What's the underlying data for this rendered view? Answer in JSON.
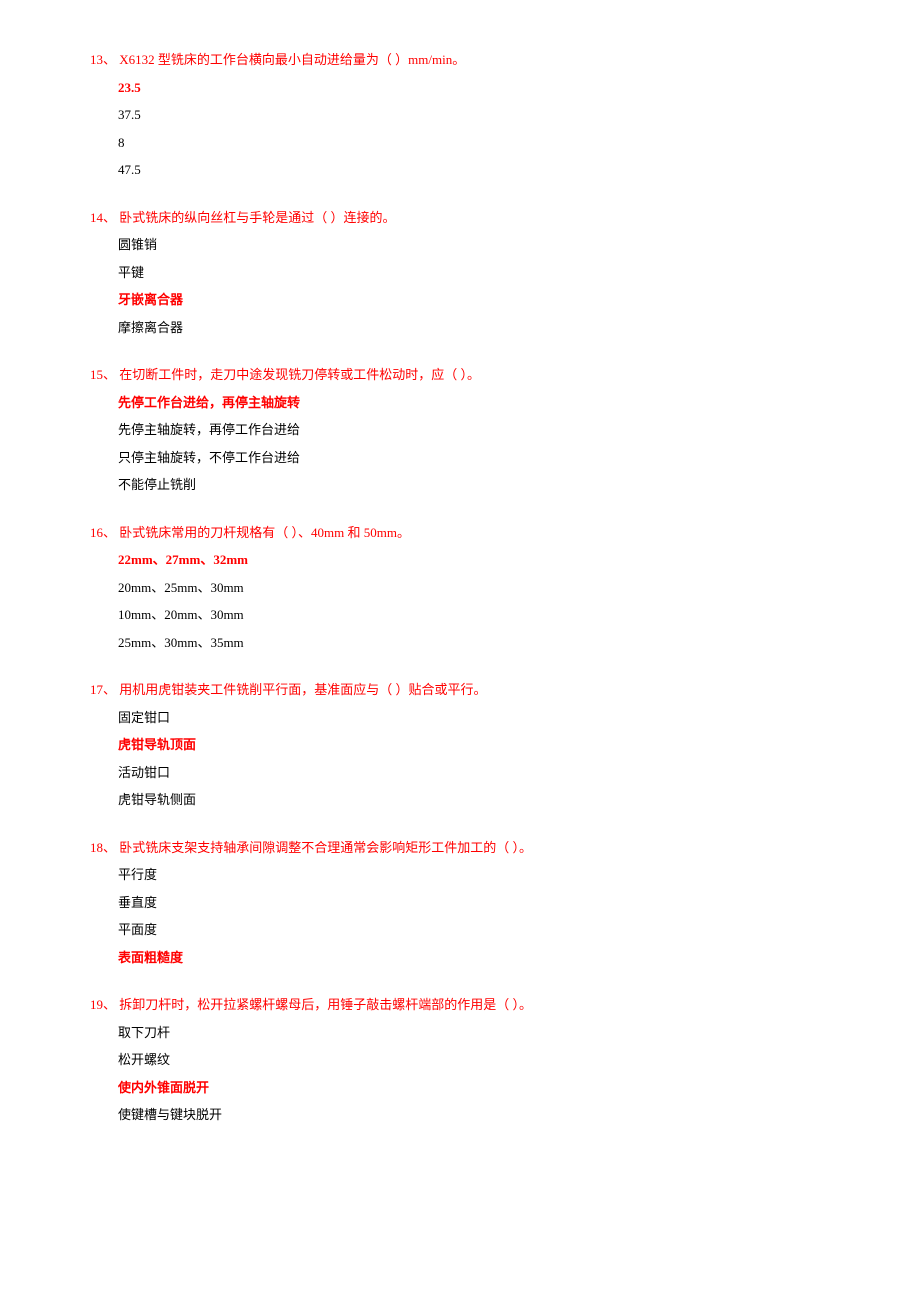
{
  "questions": [
    {
      "num": "13、",
      "text": " X6132 型铣床的工作台横向最小自动进给量为（ ）mm/min。",
      "options": [
        {
          "label": "23.5",
          "correct": true
        },
        {
          "label": "37.5",
          "correct": false
        },
        {
          "label": "8",
          "correct": false
        },
        {
          "label": "47.5",
          "correct": false
        }
      ]
    },
    {
      "num": "14、",
      "text": " 卧式铣床的纵向丝杠与手轮是通过（ ）连接的。",
      "options": [
        {
          "label": "圆锥销",
          "correct": false
        },
        {
          "label": "平键",
          "correct": false
        },
        {
          "label": "牙嵌离合器",
          "correct": true
        },
        {
          "label": "摩擦离合器",
          "correct": false
        }
      ]
    },
    {
      "num": "15、",
      "text": " 在切断工件时，走刀中途发现铣刀停转或工件松动时，应（ ）。",
      "options": [
        {
          "label": "先停工作台进给，再停主轴旋转",
          "correct": true
        },
        {
          "label": "先停主轴旋转，再停工作台进给",
          "correct": false
        },
        {
          "label": "只停主轴旋转，不停工作台进给",
          "correct": false
        },
        {
          "label": "不能停止铣削",
          "correct": false
        }
      ]
    },
    {
      "num": "16、",
      "text": " 卧式铣床常用的刀杆规格有（ ）、40mm 和 50mm。",
      "options": [
        {
          "label": "22mm、27mm、32mm",
          "correct": true
        },
        {
          "label": "20mm、25mm、30mm",
          "correct": false
        },
        {
          "label": "10mm、20mm、30mm",
          "correct": false
        },
        {
          "label": "25mm、30mm、35mm",
          "correct": false
        }
      ]
    },
    {
      "num": "17、",
      "text": " 用机用虎钳装夹工件铣削平行面，基准面应与（ ）贴合或平行。",
      "options": [
        {
          "label": "固定钳口",
          "correct": false
        },
        {
          "label": "虎钳导轨顶面",
          "correct": true
        },
        {
          "label": "活动钳口",
          "correct": false
        },
        {
          "label": "虎钳导轨侧面",
          "correct": false
        }
      ]
    },
    {
      "num": "18、",
      "text": " 卧式铣床支架支持轴承间隙调整不合理通常会影响矩形工件加工的（ ）。",
      "options": [
        {
          "label": "平行度",
          "correct": false
        },
        {
          "label": "垂直度",
          "correct": false
        },
        {
          "label": "平面度",
          "correct": false
        },
        {
          "label": "表面粗糙度",
          "correct": true
        }
      ]
    },
    {
      "num": "19、",
      "text": " 拆卸刀杆时，松开拉紧螺杆螺母后，用锤子敲击螺杆端部的作用是（ ）。",
      "options": [
        {
          "label": "取下刀杆",
          "correct": false
        },
        {
          "label": "松开螺纹",
          "correct": false
        },
        {
          "label": "使内外锥面脱开",
          "correct": true
        },
        {
          "label": "使键槽与键块脱开",
          "correct": false
        }
      ]
    }
  ]
}
